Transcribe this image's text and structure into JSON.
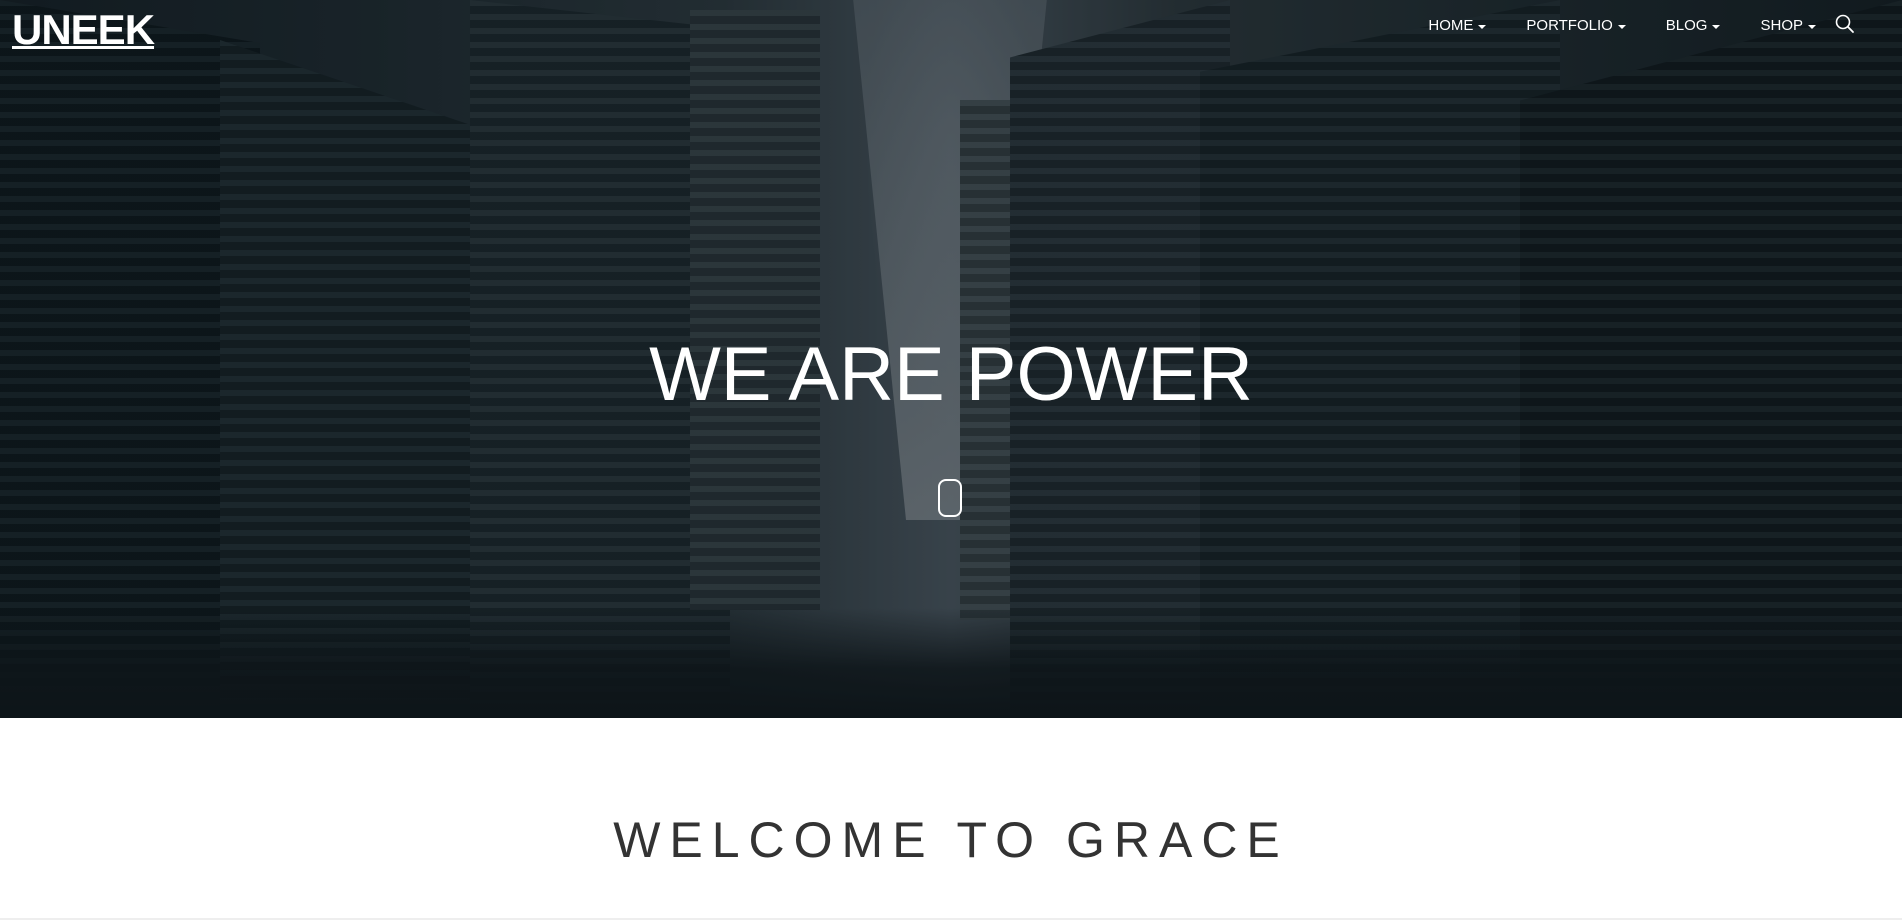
{
  "header": {
    "logo": "UNEEK",
    "nav": [
      {
        "label": "HOME"
      },
      {
        "label": "PORTFOLIO"
      },
      {
        "label": "BLOG"
      },
      {
        "label": "SHOP"
      }
    ],
    "search_icon": "search-icon"
  },
  "hero": {
    "title": "WE ARE POWER",
    "scroll_icon": "mouse-scroll-icon"
  },
  "welcome": {
    "title": "WELCOME TO GRACE"
  },
  "colors": {
    "hero_overlay": "#0e161c",
    "text_light": "#ffffff",
    "text_dark": "#333333"
  }
}
